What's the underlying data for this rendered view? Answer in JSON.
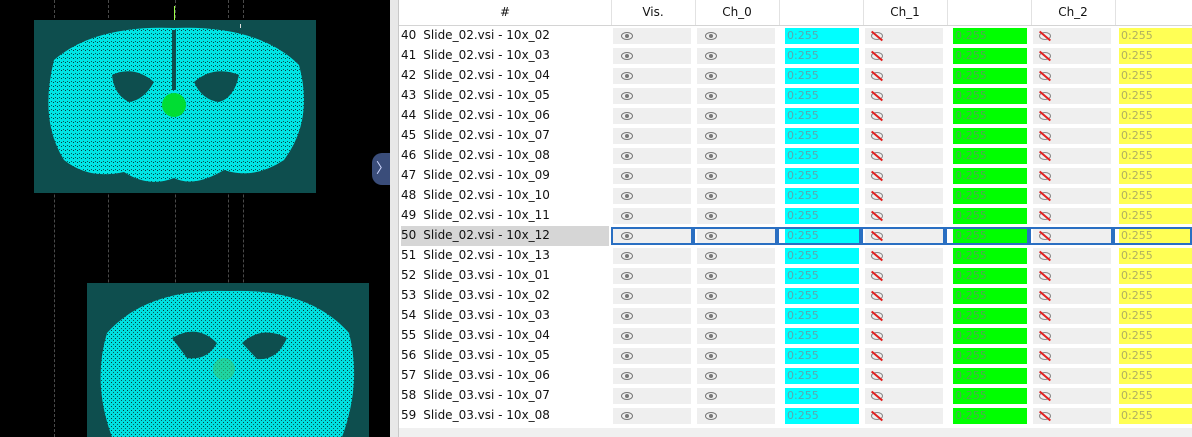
{
  "table": {
    "columns": [
      "#",
      "Vis.",
      "Ch_0",
      "",
      "Ch_1",
      "",
      "Ch_2",
      ""
    ],
    "rows": [
      {
        "id": "40",
        "name": "Slide_02.vsi - 10x_02",
        "lut": "0:255"
      },
      {
        "id": "41",
        "name": "Slide_02.vsi - 10x_03",
        "lut": "0:255"
      },
      {
        "id": "42",
        "name": "Slide_02.vsi - 10x_04",
        "lut": "0:255"
      },
      {
        "id": "43",
        "name": "Slide_02.vsi - 10x_05",
        "lut": "0:255"
      },
      {
        "id": "44",
        "name": "Slide_02.vsi - 10x_06",
        "lut": "0:255"
      },
      {
        "id": "45",
        "name": "Slide_02.vsi - 10x_07",
        "lut": "0:255"
      },
      {
        "id": "46",
        "name": "Slide_02.vsi - 10x_08",
        "lut": "0:255"
      },
      {
        "id": "47",
        "name": "Slide_02.vsi - 10x_09",
        "lut": "0:255"
      },
      {
        "id": "48",
        "name": "Slide_02.vsi - 10x_10",
        "lut": "0:255"
      },
      {
        "id": "49",
        "name": "Slide_02.vsi - 10x_11",
        "lut": "0:255"
      },
      {
        "id": "50",
        "name": "Slide_02.vsi - 10x_12",
        "lut": "0:255",
        "selected": true
      },
      {
        "id": "51",
        "name": "Slide_02.vsi - 10x_13",
        "lut": "0:255"
      },
      {
        "id": "52",
        "name": "Slide_03.vsi - 10x_01",
        "lut": "0:255"
      },
      {
        "id": "53",
        "name": "Slide_03.vsi - 10x_02",
        "lut": "0:255"
      },
      {
        "id": "54",
        "name": "Slide_03.vsi - 10x_03",
        "lut": "0:255"
      },
      {
        "id": "55",
        "name": "Slide_03.vsi - 10x_04",
        "lut": "0:255"
      },
      {
        "id": "56",
        "name": "Slide_03.vsi - 10x_05",
        "lut": "0:255"
      },
      {
        "id": "57",
        "name": "Slide_03.vsi - 10x_06",
        "lut": "0:255"
      },
      {
        "id": "58",
        "name": "Slide_03.vsi - 10x_07",
        "lut": "0:255"
      },
      {
        "id": "59",
        "name": "Slide_03.vsi - 10x_08",
        "lut": "0:255"
      }
    ]
  },
  "icons": {
    "visible": "eye-icon",
    "hidden": "eye-slash-icon",
    "collapse_handle": "chevron-right-icon"
  },
  "colors": {
    "ch0": "#00ffff",
    "ch1": "#00ff00",
    "ch2": "#ffff55",
    "selection": "#2a6fc2",
    "tissue": "#00e5e5",
    "marker": "#00dd33"
  },
  "handle_glyph": "〉"
}
